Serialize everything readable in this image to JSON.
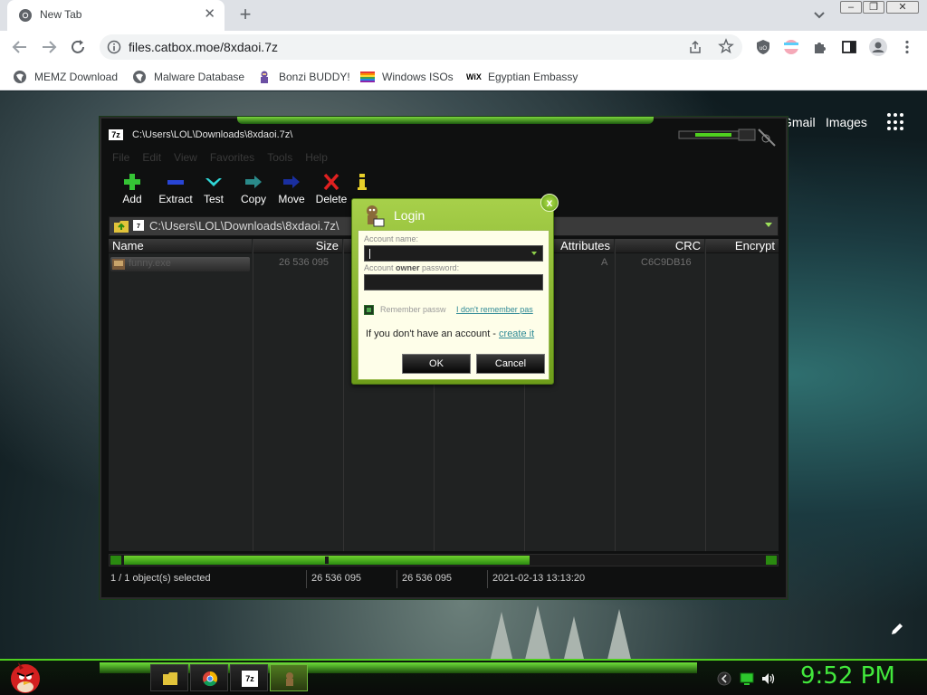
{
  "browser": {
    "tab": {
      "title": "New Tab",
      "close_glyph": "✕"
    },
    "new_tab_glyph": "+",
    "window_controls": {
      "minimize": "–",
      "maximize": "❐",
      "close": "✕"
    },
    "url": "files.catbox.moe/8xdaoi.7z",
    "bookmarks": [
      {
        "label": "MEMZ Download",
        "icon": "globe-icon"
      },
      {
        "label": "Malware Database",
        "icon": "globe-icon"
      },
      {
        "label": "Bonzi BUDDY!",
        "icon": "bonzi-icon"
      },
      {
        "label": "Windows ISOs",
        "icon": "windows-flag-icon"
      },
      {
        "label": "Egyptian Embassy",
        "icon": "wix-icon"
      }
    ],
    "wix_logo_text": "WiX"
  },
  "page": {
    "links": {
      "gmail": "Gmail",
      "images": "Images"
    }
  },
  "sevenzip": {
    "title": "C:\\Users\\LOL\\Downloads\\8xdaoi.7z\\",
    "app_icon_text": "7z",
    "menu": [
      "File",
      "Edit",
      "View",
      "Favorites",
      "Tools",
      "Help"
    ],
    "toolbar": {
      "add": "Add",
      "extract": "Extract",
      "test": "Test",
      "copy": "Copy",
      "move": "Move",
      "delete": "Delete",
      "info": ""
    },
    "address": "C:\\Users\\LOL\\Downloads\\8xdaoi.7z\\",
    "columns": {
      "name": "Name",
      "size": "Size",
      "attributes": "Attributes",
      "crc": "CRC",
      "encrypted": "Encrypt"
    },
    "files": [
      {
        "name": "funny.exe",
        "size": "26 536 095",
        "attributes": "A",
        "crc": "C6C9DB16"
      }
    ],
    "status": {
      "selected": "1 / 1 object(s) selected",
      "size": "26 536 095",
      "packed": "26 536 095",
      "modified": "2021-02-13 13:13:20"
    }
  },
  "login_dialog": {
    "title": "Login",
    "close_glyph": "x",
    "account_label": "Account name:",
    "password_label_pre": "Account ",
    "password_label_bold": "owner",
    "password_label_post": " password:",
    "remember": "Remember passw",
    "forgot": "I don't remember pas",
    "no_account": "If you don't have an account - ",
    "create_link": "create it",
    "ok": "OK",
    "cancel": "Cancel"
  },
  "taskbar": {
    "clock": "9:52 PM",
    "sevenzip_icon_text": "7z"
  },
  "colors": {
    "accent_green": "#42e83c",
    "dialog_green": "#8fbf30",
    "link_teal": "#2f8a96"
  }
}
